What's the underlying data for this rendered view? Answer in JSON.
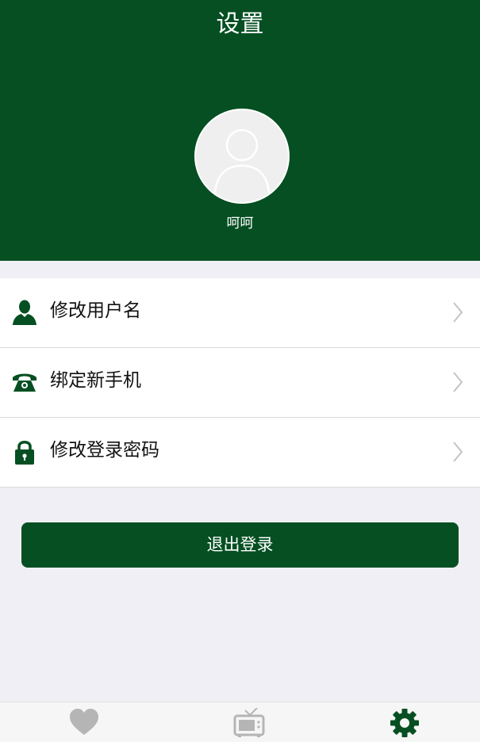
{
  "header": {
    "title": "设置",
    "background": "#054f22",
    "username": "呵呵",
    "avatar_icon": "user-placeholder-icon"
  },
  "settings": {
    "items": [
      {
        "label": "修改用户名",
        "icon": "user-icon"
      },
      {
        "label": "绑定新手机",
        "icon": "telephone-icon"
      },
      {
        "label": "修改登录密码",
        "icon": "lock-icon"
      }
    ],
    "chevron_icon": "chevron-right-icon"
  },
  "logout": {
    "label": "退出登录",
    "color": "#054f22"
  },
  "tabbar": {
    "tabs": [
      {
        "icon": "heart-icon",
        "active": false
      },
      {
        "icon": "tv-icon",
        "active": false
      },
      {
        "icon": "gear-icon",
        "active": true
      }
    ],
    "active_color": "#054f22",
    "inactive_color": "#b5b5b5"
  }
}
